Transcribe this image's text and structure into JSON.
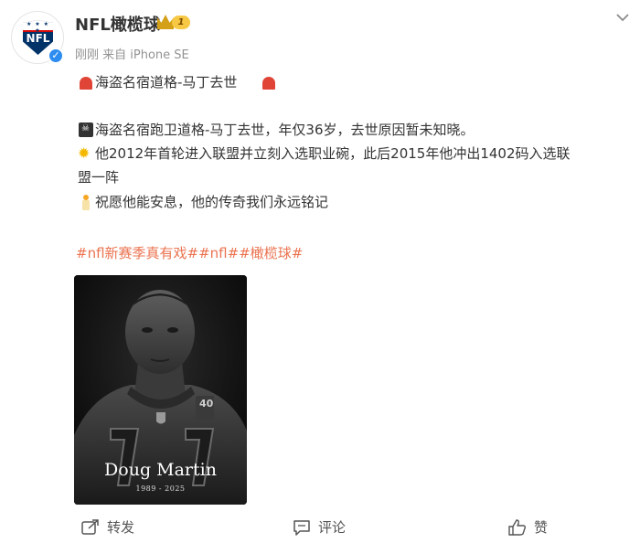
{
  "user": {
    "name": "NFL橄榄球",
    "badge_level": "1",
    "meta": "刚刚  来自 iPhone SE",
    "avatar_text": "NFL"
  },
  "post": {
    "title": "海盗名宿道格-马丁去世",
    "line1": "海盗名宿跑卫道格-马丁去世，年仅36岁，去世原因暂未知晓。",
    "line2a": "他2012年首轮进入联盟并立刻入选职业碗，此后2015年他冲出1402码入选联",
    "line2b": "盟一阵",
    "line3": "祝愿他能安息，他的传奇我们永远铭记",
    "hashtags": [
      "#nfl新赛季真有戏#",
      "#nfl#",
      "#橄榄球#"
    ]
  },
  "photo": {
    "name": "Doug Martin",
    "years": "1989 - 2025",
    "patch": "40"
  },
  "actions": {
    "share": "转发",
    "comment": "评论",
    "like": "赞"
  },
  "colors": {
    "hashtag": "#eb7350",
    "verified": "#2d8cf0",
    "nfl_blue": "#013369",
    "nfl_red": "#d50a0a"
  },
  "icons": [
    "siren-icon",
    "pirate-flag-icon",
    "sun-icon",
    "candle-icon",
    "share-icon",
    "comment-icon",
    "thumbs-up-icon",
    "chevron-down-icon",
    "verified-icon",
    "crown-icon"
  ]
}
